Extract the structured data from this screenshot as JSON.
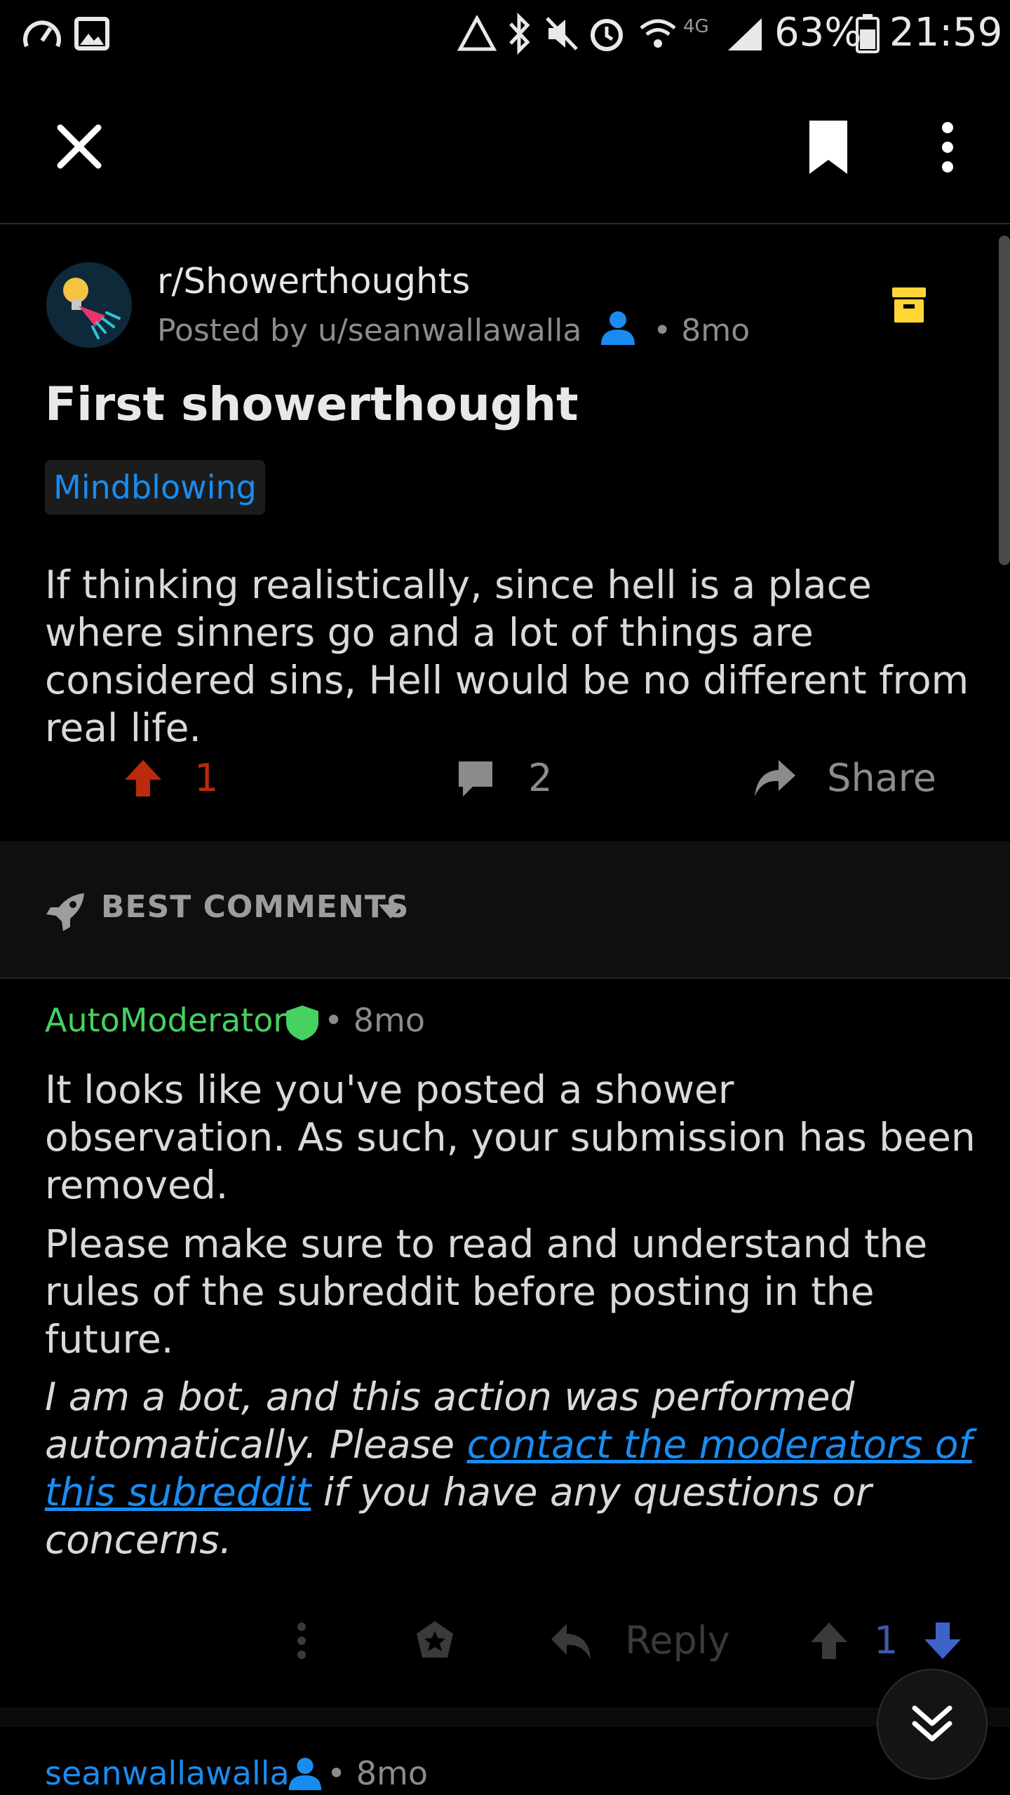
{
  "status_bar": {
    "battery": "63%",
    "time": "21:59"
  },
  "post": {
    "subreddit": "r/Showerthoughts",
    "posted_by": "Posted by u/seanwallawalla",
    "age": "• 8mo",
    "title": "First showerthought",
    "flair": "Mindblowing",
    "body": "If thinking realistically, since hell is a place where sinners go and a lot of things are considered sins, Hell would be no different from real life.",
    "upvotes": "1",
    "comments": "2",
    "share_label": "Share"
  },
  "sort": {
    "label": "BEST COMMENTS"
  },
  "comment": {
    "author": "AutoModerator",
    "age": "• 8mo",
    "p1": "It looks like you've posted a shower observation. As such, your submission has been removed.",
    "p2": "Please make sure to read and understand the rules of the subreddit before posting in the future.",
    "p3_pre": "I am a bot, and this action was performed automatically. Please ",
    "p3_link": "contact the moderators of this subreddit",
    "p3_post": " if you have any questions or concerns.",
    "reply_label": "Reply",
    "score": "1"
  },
  "next_comment": {
    "author": "seanwallawalla",
    "age": "• 8mo"
  },
  "colors": {
    "upvote": "#ba2a0c",
    "mod_green": "#46d160",
    "link_blue": "#1a8cf0",
    "archive_yellow": "#ffd635",
    "downvote": "#3d63c9"
  }
}
